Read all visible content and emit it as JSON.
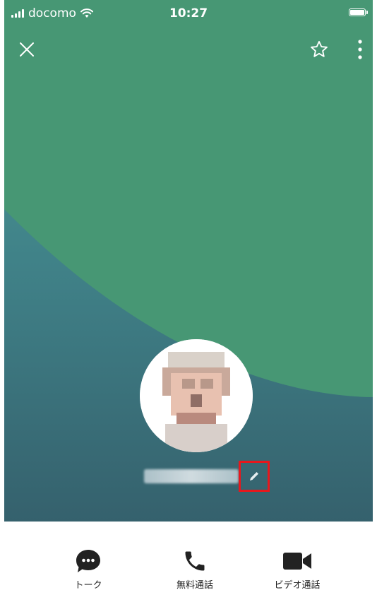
{
  "status_bar": {
    "carrier": "docomo",
    "time": "10:27"
  },
  "header": {
    "close_icon": "close-icon",
    "favorite_icon": "star-outline-icon",
    "more_icon": "vertical-ellipsis-icon"
  },
  "profile": {
    "edit_icon": "pencil-icon",
    "highlight_color": "#e8171c"
  },
  "colors": {
    "hero_green": "#479774",
    "hero_teal": "#4b9d9b",
    "hero_dark": "#35616d",
    "action_icon": "#222222"
  },
  "actions": [
    {
      "label": "トーク",
      "icon": "chat-bubble-icon"
    },
    {
      "label": "無料通話",
      "icon": "phone-icon"
    },
    {
      "label": "ビデオ通話",
      "icon": "video-camera-icon"
    }
  ]
}
